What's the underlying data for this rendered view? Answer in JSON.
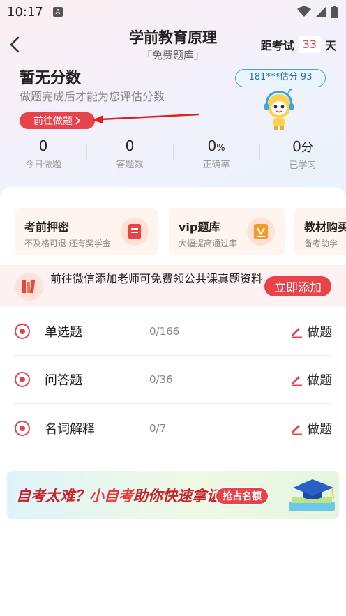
{
  "status_bar": {
    "time": "10:17",
    "notification_glyph": "A"
  },
  "header": {
    "title": "学前教育原理",
    "subtitle": "「免费题库」",
    "countdown_prefix": "距考试",
    "countdown_days": "33",
    "countdown_suffix": "天"
  },
  "score": {
    "title": "暂无分数",
    "description": "做题完成后才能为您评估分数",
    "goto_label": "前往做题",
    "bubble_text": "181***估分 93"
  },
  "stats": [
    {
      "value": "0",
      "unit": "",
      "label": "今日做题"
    },
    {
      "value": "0",
      "unit": "",
      "label": "答题数"
    },
    {
      "value": "0",
      "unit": "%",
      "label": "正确率"
    },
    {
      "value": "0",
      "unit": "分",
      "label": "已学习"
    }
  ],
  "promos": [
    {
      "title": "考前押密",
      "subtitle": "不及格可退 还有奖学金",
      "icon": "secret-doc-icon"
    },
    {
      "title": "vip题库",
      "subtitle": "大幅提高通过率",
      "icon": "vip-book-icon"
    },
    {
      "title": "教材购买",
      "subtitle": "备考助学",
      "icon": "textbook-icon"
    }
  ],
  "wechat": {
    "text": "前往微信添加老师可免费领公共课真题资料",
    "button": "立即添加"
  },
  "questions": [
    {
      "name": "单选题",
      "progress": "0/166",
      "action": "做题"
    },
    {
      "name": "问答题",
      "progress": "0/36",
      "action": "做题"
    },
    {
      "name": "名词解释",
      "progress": "0/7",
      "action": "做题"
    }
  ],
  "ad": {
    "text_part1": "自考太难？",
    "text_highlight": "小自考",
    "text_part2": "助你快速拿证",
    "button": "抢占名额"
  },
  "colors": {
    "accent": "#e8434a",
    "bubble_border": "#3aa4e8"
  }
}
